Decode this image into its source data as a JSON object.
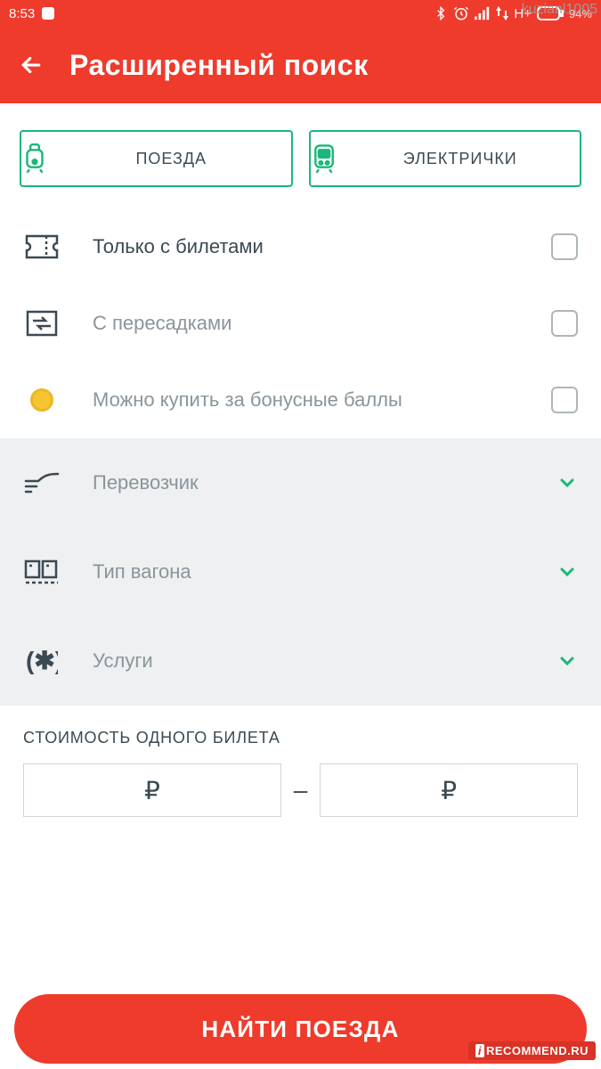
{
  "statusbar": {
    "time": "8:53",
    "network": "H+",
    "battery": "94%"
  },
  "watermark_top": "kuzianl1005",
  "watermark_bottom": "RECOMMEND.RU",
  "header": {
    "title": "Расширенный поиск"
  },
  "tabs": [
    {
      "label": "ПОЕЗДА",
      "icon": "train-icon"
    },
    {
      "label": "ЭЛЕКТРИЧКИ",
      "icon": "suburban-train-icon"
    }
  ],
  "filters": {
    "tickets_only": "Только с билетами",
    "transfers": "С пересадками",
    "bonus": "Можно купить за бонусные баллы"
  },
  "dropdowns": {
    "carrier": "Перевозчик",
    "car_type": "Тип вагона",
    "services": "Услуги"
  },
  "price": {
    "title": "СТОИМОСТЬ ОДНОГО БИЛЕТА",
    "currency": "₽",
    "separator": "–"
  },
  "search_button": "НАЙТИ ПОЕЗДА"
}
